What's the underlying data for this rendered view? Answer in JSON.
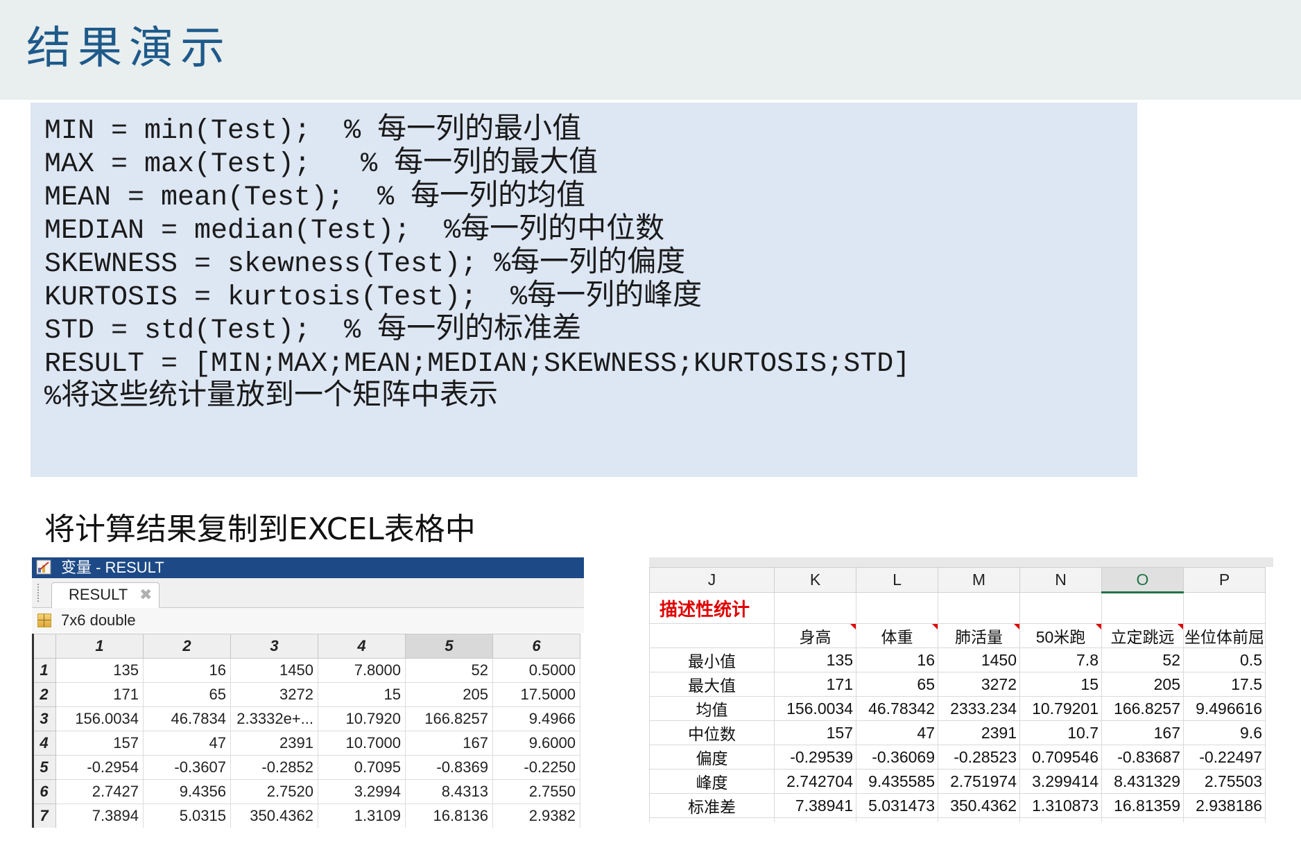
{
  "slide": {
    "title": "结果演示",
    "subtitle": "将计算结果复制到EXCEL表格中"
  },
  "code": [
    {
      "code": "MIN = min(Test);  % ",
      "comment": "每一列的最小值"
    },
    {
      "code": "MAX = max(Test);   % ",
      "comment": "每一列的最大值"
    },
    {
      "code": "MEAN = mean(Test);  % ",
      "comment": "每一列的均值"
    },
    {
      "code": "MEDIAN = median(Test);  %",
      "comment": "每一列的中位数"
    },
    {
      "code": "SKEWNESS = skewness(Test); %",
      "comment": "每一列的偏度"
    },
    {
      "code": "KURTOSIS = kurtosis(Test);  %",
      "comment": "每一列的峰度"
    },
    {
      "code": "STD = std(Test);  % ",
      "comment": "每一列的标准差"
    },
    {
      "code": "RESULT = [MIN;MAX;MEAN;MEDIAN;SKEWNESS;KURTOSIS;STD]",
      "comment": ""
    },
    {
      "code": "%",
      "comment": "将这些统计量放到一个矩阵中表示"
    }
  ],
  "matlab": {
    "window_title": "变量 - RESULT",
    "tab_label": "RESULT",
    "tab_close": "✖",
    "info": "7x6 double",
    "columns": [
      "1",
      "2",
      "3",
      "4",
      "5",
      "6"
    ],
    "rows": [
      {
        "index": "1",
        "cells": [
          "135",
          "16",
          "1450",
          "7.8000",
          "52",
          "0.5000"
        ]
      },
      {
        "index": "2",
        "cells": [
          "171",
          "65",
          "3272",
          "15",
          "205",
          "17.5000"
        ]
      },
      {
        "index": "3",
        "cells": [
          "156.0034",
          "46.7834",
          "2.3332e+...",
          "10.7920",
          "166.8257",
          "9.4966"
        ]
      },
      {
        "index": "4",
        "cells": [
          "157",
          "47",
          "2391",
          "10.7000",
          "167",
          "9.6000"
        ]
      },
      {
        "index": "5",
        "cells": [
          "-0.2954",
          "-0.3607",
          "-0.2852",
          "0.7095",
          "-0.8369",
          "-0.2250"
        ]
      },
      {
        "index": "6",
        "cells": [
          "2.7427",
          "9.4356",
          "2.7520",
          "3.2994",
          "8.4313",
          "2.7550"
        ]
      },
      {
        "index": "7",
        "cells": [
          "7.3894",
          "5.0315",
          "350.4362",
          "1.3109",
          "16.8136",
          "2.9382"
        ]
      }
    ]
  },
  "excel": {
    "columns": [
      "J",
      "K",
      "L",
      "M",
      "N",
      "O",
      "P"
    ],
    "selected_column": "O",
    "title": "描述性统计",
    "headers": [
      "身高",
      "体重",
      "肺活量",
      "50米跑",
      "立定跳远",
      "坐位体前屈"
    ],
    "rows": [
      {
        "label": "最小值",
        "cells": [
          "135",
          "16",
          "1450",
          "7.8",
          "52",
          "0.5"
        ]
      },
      {
        "label": "最大值",
        "cells": [
          "171",
          "65",
          "3272",
          "15",
          "205",
          "17.5"
        ]
      },
      {
        "label": "均值",
        "cells": [
          "156.0034",
          "46.78342",
          "2333.234",
          "10.79201",
          "166.8257",
          "9.496616"
        ]
      },
      {
        "label": "中位数",
        "cells": [
          "157",
          "47",
          "2391",
          "10.7",
          "167",
          "9.6"
        ]
      },
      {
        "label": "偏度",
        "cells": [
          "-0.29539",
          "-0.36069",
          "-0.28523",
          "0.709546",
          "-0.83687",
          "-0.22497"
        ]
      },
      {
        "label": "峰度",
        "cells": [
          "2.742704",
          "9.435585",
          "2.751974",
          "3.299414",
          "8.431329",
          "2.75503"
        ]
      },
      {
        "label": "标准差",
        "cells": [
          "7.38941",
          "5.031473",
          "350.4362",
          "1.310873",
          "16.81359",
          "2.938186"
        ]
      }
    ]
  },
  "colors": {
    "title": "#1e5a8a",
    "code_background": "#dde6f3",
    "matlab_titlebar": "#1d4a86",
    "excel_accent": "#217346",
    "excel_title": "#e00000"
  },
  "icons": {
    "matlab_window": "variable-editor-icon",
    "matlab_grid": "grid-icon",
    "excel_comment": "comment-indicator-icon"
  }
}
